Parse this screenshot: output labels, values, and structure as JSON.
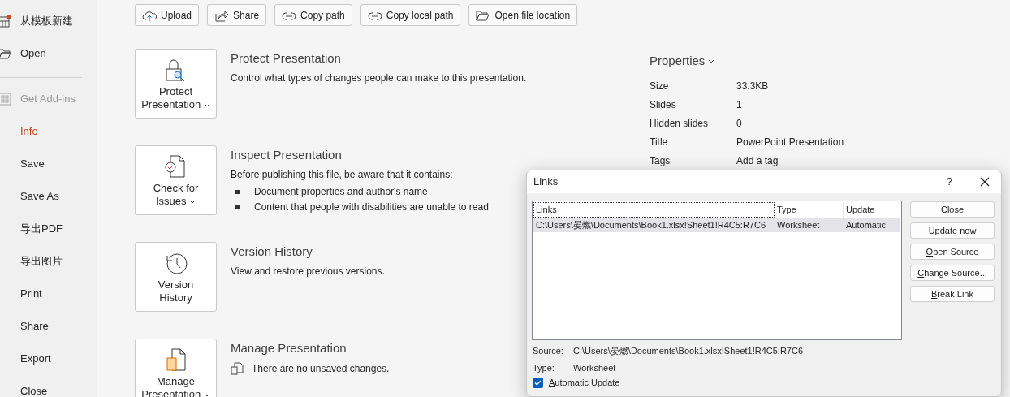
{
  "sidebar": {
    "groups": [
      [
        {
          "label": "从模板新建",
          "kind": "template",
          "selected": false,
          "disabled": false
        },
        {
          "label": "Open",
          "kind": "open",
          "selected": false,
          "disabled": false
        }
      ],
      [
        {
          "label": "Get Add-ins",
          "kind": "addins",
          "selected": false,
          "disabled": true
        },
        {
          "label": "Info",
          "kind": "plain",
          "selected": true,
          "disabled": false
        },
        {
          "label": "Save",
          "kind": "plain",
          "selected": false,
          "disabled": false
        },
        {
          "label": "Save As",
          "kind": "plain",
          "selected": false,
          "disabled": false
        },
        {
          "label": "导出PDF",
          "kind": "plain",
          "selected": false,
          "disabled": false
        },
        {
          "label": "导出图片",
          "kind": "plain",
          "selected": false,
          "disabled": false
        },
        {
          "label": "Print",
          "kind": "plain",
          "selected": false,
          "disabled": false
        },
        {
          "label": "Share",
          "kind": "plain",
          "selected": false,
          "disabled": false
        },
        {
          "label": "Export",
          "kind": "plain",
          "selected": false,
          "disabled": false
        },
        {
          "label": "Close",
          "kind": "plain",
          "selected": false,
          "disabled": false
        }
      ]
    ]
  },
  "toolbar": [
    {
      "label": "Upload",
      "kind": "upload"
    },
    {
      "label": "Share",
      "kind": "share"
    },
    {
      "label": "Copy path",
      "kind": "link"
    },
    {
      "label": "Copy local path",
      "kind": "link"
    },
    {
      "label": "Open file location",
      "kind": "folder"
    }
  ],
  "sections": [
    {
      "kind": "protect",
      "tile_label": "Protect Presentation",
      "dropdown": true,
      "title": "Protect Presentation",
      "description": "Control what types of changes people can make to this presentation."
    },
    {
      "kind": "inspect",
      "tile_label": "Check for Issues",
      "dropdown": true,
      "title": "Inspect Presentation",
      "description": "Before publishing this file, be aware that it contains:",
      "bullets": [
        "Document properties and author's name",
        "Content that people with disabilities are unable to read"
      ]
    },
    {
      "kind": "history",
      "tile_label": "Version History",
      "dropdown": false,
      "title": "Version History",
      "description": "View and restore previous versions."
    },
    {
      "kind": "manage",
      "tile_label": "Manage Presentation",
      "dropdown": true,
      "title": "Manage Presentation",
      "note": "There are no unsaved changes."
    }
  ],
  "properties": {
    "title": "Properties",
    "rows": [
      {
        "label": "Size",
        "value": "33.3KB"
      },
      {
        "label": "Slides",
        "value": "1"
      },
      {
        "label": "Hidden slides",
        "value": "0"
      },
      {
        "label": "Title",
        "value": "PowerPoint Presentation"
      },
      {
        "label": "Tags",
        "value": "Add a tag"
      }
    ]
  },
  "dialog": {
    "title": "Links",
    "help": "?",
    "table": {
      "columns": [
        "Links",
        "Type",
        "Update"
      ],
      "rows": [
        {
          "cells": [
            "C:\\Users\\晏燃\\Documents\\Book1.xlsx!Sheet1!R4C5:R7C6",
            "Worksheet",
            "Automatic"
          ],
          "selected": true
        }
      ]
    },
    "buttons": [
      {
        "label": "Close",
        "mnemonic_underlined": false
      },
      {
        "label": "Update now",
        "mnemonic_underlined": true
      },
      {
        "label": "Open Source",
        "mnemonic_underlined": true
      },
      {
        "label": "Change Source...",
        "mnemonic_underlined": true
      },
      {
        "label": "Break Link",
        "mnemonic_underlined": true
      }
    ],
    "source_label": "Source:",
    "source_value": "C:\\Users\\晏燃\\Documents\\Book1.xlsx!Sheet1!R4C5:R7C6",
    "type_label": "Type:",
    "type_value": "Worksheet",
    "auto_update": {
      "label": "Automatic Update",
      "mnemonic_underlined": true,
      "checked": true
    }
  }
}
